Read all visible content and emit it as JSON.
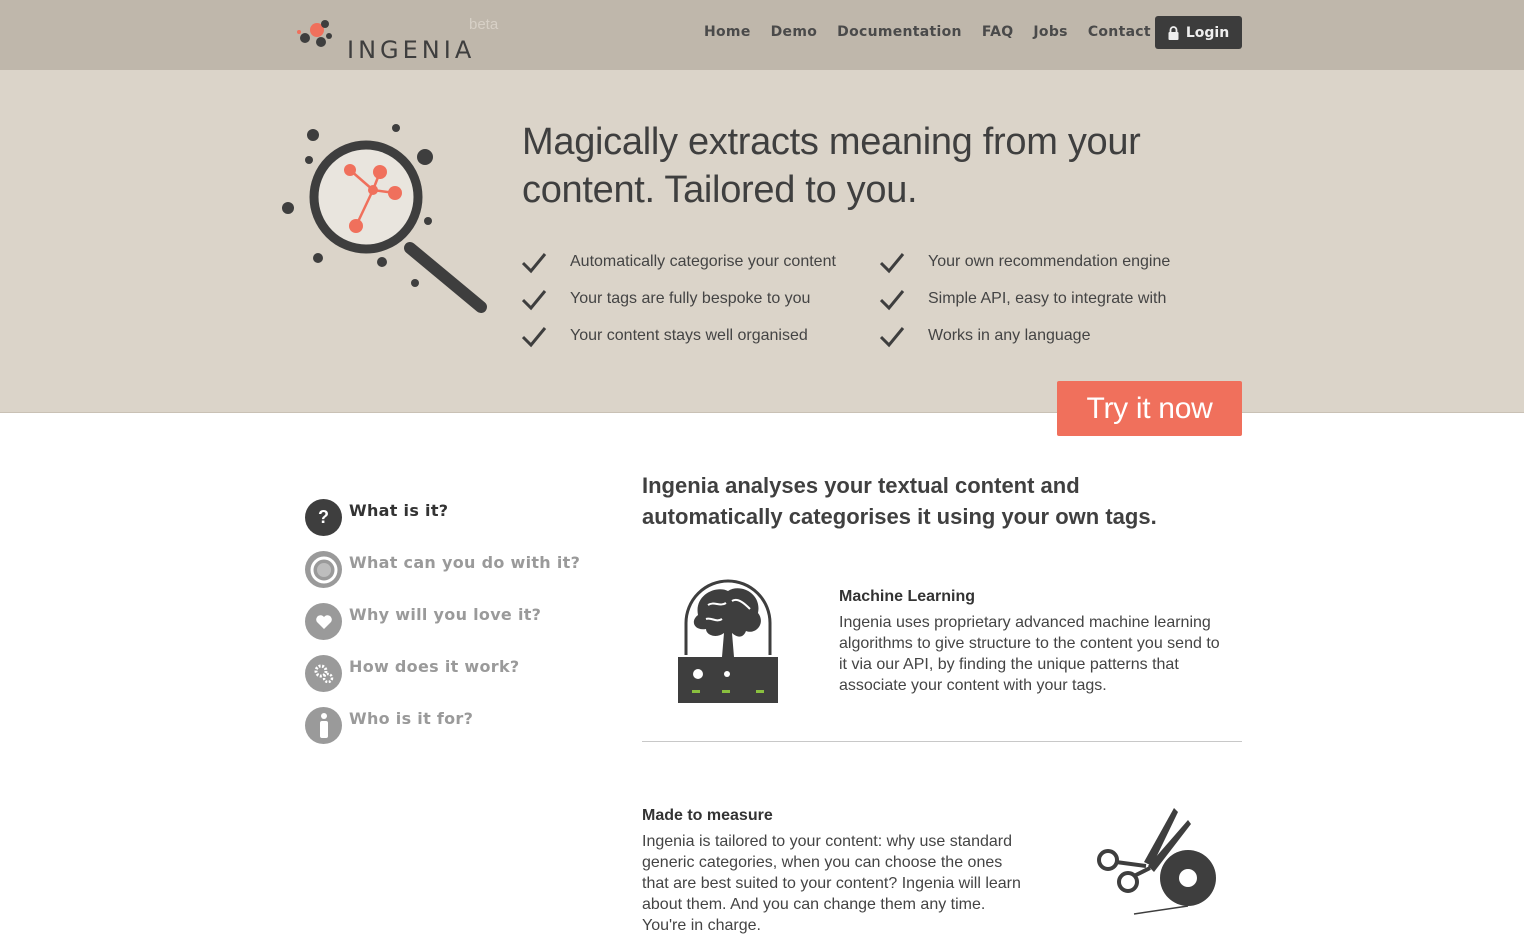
{
  "brand": {
    "name": "INGENIA",
    "badge": "beta"
  },
  "nav": {
    "items": [
      {
        "label": "Home",
        "active": true
      },
      {
        "label": "Demo",
        "active": false
      },
      {
        "label": "Documentation",
        "active": false
      },
      {
        "label": "FAQ",
        "active": false
      },
      {
        "label": "Jobs",
        "active": false
      },
      {
        "label": "Contact",
        "active": false
      }
    ],
    "login_label": "Login"
  },
  "hero": {
    "title_line1": "Magically extracts meaning from your",
    "title_line2": "content. Tailored to you.",
    "features": [
      "Automatically categorise your content",
      "Your tags are fully bespoke to you",
      "Your content stays well organised",
      "Your own recommendation engine",
      "Simple API, easy to integrate with",
      "Works in any language"
    ],
    "cta_label": "Try it now"
  },
  "side_menu": [
    {
      "label": "What is it?",
      "icon": "question-icon",
      "active": true
    },
    {
      "label": "What can you do with it?",
      "icon": "target-icon",
      "active": false
    },
    {
      "label": "Why will you love it?",
      "icon": "heart-icon",
      "active": false
    },
    {
      "label": "How does it work?",
      "icon": "gears-icon",
      "active": false
    },
    {
      "label": "Who is it for?",
      "icon": "person-icon",
      "active": false
    }
  ],
  "content": {
    "intro_line1": "Ingenia analyses your textual content and",
    "intro_line2": "automatically categorises it using your own tags.",
    "ml": {
      "title": "Machine Learning",
      "lines": [
        "Ingenia uses proprietary advanced machine learning",
        "algorithms to give structure to the content you send to",
        "it via our API, by finding the unique patterns that",
        "associate your content with your tags."
      ]
    },
    "measure": {
      "title": "Made to measure",
      "lines": [
        "Ingenia is tailored to your content: why use standard",
        "generic categories, when you can choose the ones",
        "that are best suited to your content? Ingenia will learn",
        "about them. And you can change them any time.",
        "You're in charge."
      ]
    }
  },
  "colors": {
    "topbar": "#bfb7ab",
    "hero_bg": "#dbd4c9",
    "accent": "#f0705c",
    "dark": "#3e3e3e",
    "muted": "#9a9a9a"
  }
}
